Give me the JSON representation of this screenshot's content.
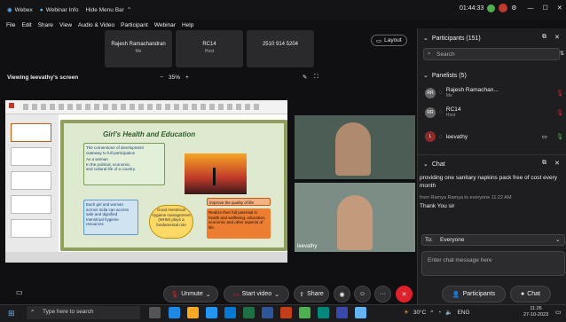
{
  "topbar": {
    "app_tab": "Webex",
    "webinar_info": "Webinar Info",
    "hide_menu": "Hide Menu Bar",
    "timer": "01:44:33",
    "close_glyph": "✕"
  },
  "menu": [
    "File",
    "Edit",
    "Share",
    "View",
    "Audio & Video",
    "Participant",
    "Webinar",
    "Help"
  ],
  "tiles": [
    {
      "name": "Rajesh Ramachandran",
      "role": "Me"
    },
    {
      "name": "RC14",
      "role": "Host"
    },
    {
      "name": "2510 914 5204",
      "role": ""
    }
  ],
  "layout_button": "Layout",
  "share": {
    "label": "Viewing leevathy's screen",
    "zoom": "35%",
    "minus": "−",
    "plus": "+"
  },
  "slide": {
    "title": "Girl's Health and Education",
    "box1": "The cornerstone of development",
    "box1b": "Gateway to full participation",
    "box1c": "As a woman",
    "box1d": "In the political, economic,",
    "box1e": "and cultural life of a country.",
    "box2": "Each girl and woman across India can access safe and dignified menstrual hygiene resources",
    "box3": "Good menstrual hygiene management (MHM) plays a fundamental role",
    "box4": "Improve the quality of life",
    "box5": "Realize their full potential in health and wellbeing, education, economic and other aspects of life."
  },
  "video2_label": "leevathy",
  "panel": {
    "participants_title": "Participants (151)",
    "search_placeholder": "Search",
    "panelists_title": "Panelists (5)",
    "panelists": [
      {
        "initials": "RR",
        "name": "Rajesh Ramachan...",
        "role": "Me"
      },
      {
        "initials": "RR",
        "name": "RC14",
        "role": "Host"
      },
      {
        "initials": "L",
        "name": "leevathy",
        "role": ""
      }
    ],
    "chat_title": "Chat",
    "chat_text1": "providing one sanitary napkins pack free of cost every month",
    "chat_meta": "from Ramya Ramya to everyone   11:22 AM",
    "chat_text2": "Thank You sir",
    "to_label": "To:",
    "to_value": "Everyone",
    "chat_placeholder": "Enter chat message here"
  },
  "controls": {
    "unmute": "Unmute",
    "start_video": "Start video",
    "share": "Share",
    "participants": "Participants",
    "chat": "Chat"
  },
  "taskbar": {
    "search_placeholder": "Type here to search",
    "temp": "30°C",
    "lang": "ENG",
    "time": "11:26",
    "date": "27-10-2023"
  },
  "colors": {
    "leave": "#e0202a",
    "accent": "#64b5f6",
    "slide_bg": "#dfe9cf"
  }
}
